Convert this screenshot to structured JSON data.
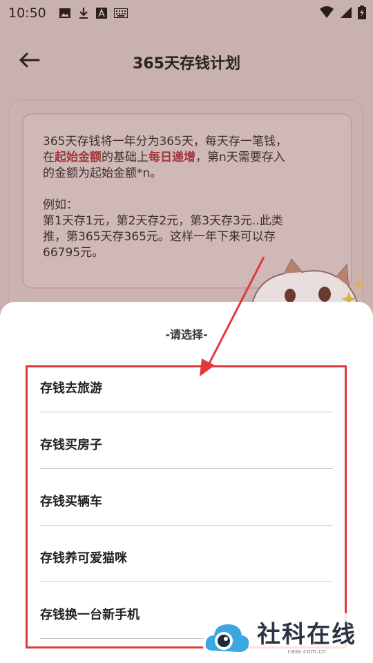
{
  "status_bar": {
    "time": "10:50"
  },
  "header": {
    "title": "365天存钱计划"
  },
  "description": {
    "line1": "365天存钱将一年分为365天，每天存一笔钱，",
    "line2_prefix": "在",
    "line2_hl1": "起始金额",
    "line2_mid": "的基础上",
    "line2_hl2": "每日递增",
    "line2_suffix": "，第n天需要存入",
    "line3": "的金额为起始金额*n。",
    "example_label": "例如：",
    "example1": "第1天存1元，第2天存2元，第3天存3元..此类",
    "example2": "推，第365天存365元。这样一年下来可以存",
    "example3": "66795元。"
  },
  "sheet": {
    "title": "-请选择-",
    "options": [
      "存钱去旅游",
      "存钱买房子",
      "存钱买辆车",
      "存钱养可爱猫咪",
      "存钱换一台新手机"
    ]
  },
  "watermark": {
    "name": "社科在线",
    "url": "cass.com.cn"
  },
  "colors": {
    "highlight_text": "#a2353c",
    "annotation_red": "#e0393c"
  }
}
